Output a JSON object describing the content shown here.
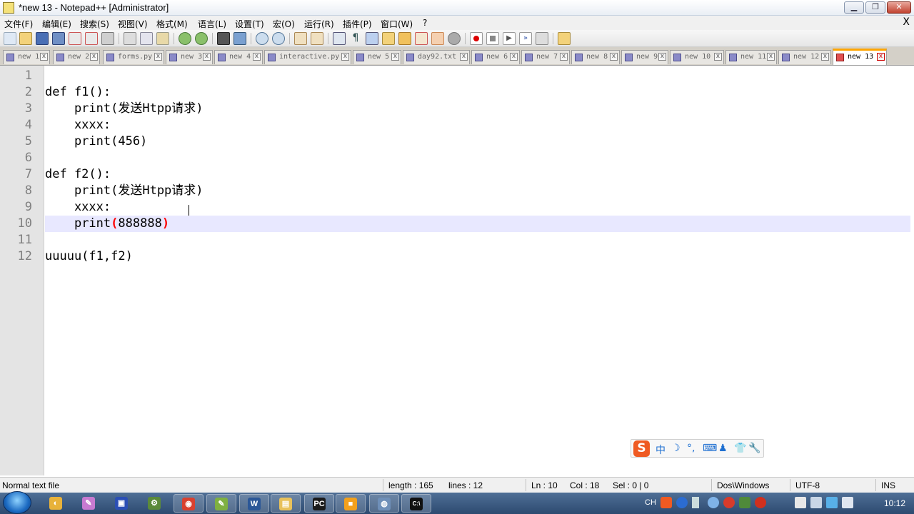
{
  "window": {
    "title": "*new 13 - Notepad++ [Administrator]",
    "min": "▁",
    "max": "❐",
    "close": "✕"
  },
  "menu": {
    "items": [
      "文件(F)",
      "编辑(E)",
      "搜索(S)",
      "视图(V)",
      "格式(M)",
      "语言(L)",
      "设置(T)",
      "宏(O)",
      "运行(R)",
      "插件(P)",
      "窗口(W)",
      "?"
    ],
    "close_doc": "X"
  },
  "tabs": [
    {
      "label": "new 1"
    },
    {
      "label": "new 2"
    },
    {
      "label": "forms.py"
    },
    {
      "label": "new 3"
    },
    {
      "label": "new 4"
    },
    {
      "label": "interactive.py"
    },
    {
      "label": "new 5"
    },
    {
      "label": "day92.txt"
    },
    {
      "label": "new 6"
    },
    {
      "label": "new 7"
    },
    {
      "label": "new 8"
    },
    {
      "label": "new 9"
    },
    {
      "label": "new 10"
    },
    {
      "label": "new 11"
    },
    {
      "label": "new 12"
    },
    {
      "label": "new 13",
      "active": true
    }
  ],
  "tab_close_glyph": "x",
  "editor": {
    "current_line": 10,
    "lines": [
      "",
      "def f1():",
      "    print(发送Htpp请求)",
      "    xxxx:",
      "    print(456)",
      "",
      "def f2():",
      "    print(发送Htpp请求)",
      "    xxxx:",
      "    print(888888)",
      "",
      "uuuuu(f1,f2)"
    ],
    "line10": {
      "indent": "    ",
      "func": "print",
      "open": "(",
      "value": "888888",
      "close": ")"
    },
    "line_numbers": [
      "1",
      "2",
      "3",
      "4",
      "5",
      "6",
      "7",
      "8",
      "9",
      "10",
      "11",
      "12"
    ]
  },
  "ime": {
    "logo": "S",
    "items": [
      "中",
      "☽",
      "°,",
      "⌨",
      "♟",
      "👕",
      "🔧"
    ]
  },
  "status": {
    "file_type": "Normal text file",
    "length": "length : 165",
    "lines": "lines : 12",
    "ln": "Ln : 10",
    "col": "Col : 18",
    "sel": "Sel : 0 | 0",
    "eol": "Dos\\Windows",
    "encoding": "UTF-8",
    "mode": "INS"
  },
  "taskbar": {
    "apps": [
      {
        "name": "chrome-like",
        "glyph": "◐",
        "color": "#e8b23a",
        "open": false
      },
      {
        "name": "paint",
        "glyph": "✎",
        "color": "#c77ad1",
        "open": false
      },
      {
        "name": "save",
        "glyph": "▣",
        "color": "#2b4fb5",
        "open": false
      },
      {
        "name": "tool",
        "glyph": "⚙",
        "color": "#5b8a3a",
        "open": false
      },
      {
        "name": "chrome",
        "glyph": "◉",
        "color": "#d9412f",
        "open": true
      },
      {
        "name": "notepad",
        "glyph": "✎",
        "color": "#7fb041",
        "open": true
      },
      {
        "name": "word",
        "glyph": "W",
        "color": "#2b5797",
        "open": true
      },
      {
        "name": "explorer",
        "glyph": "▤",
        "color": "#e8c15a",
        "open": true
      },
      {
        "name": "pycharm",
        "glyph": "PC",
        "color": "#1b1b1b",
        "open": true
      },
      {
        "name": "app-orange",
        "glyph": "■",
        "color": "#f2a01c",
        "open": true
      },
      {
        "name": "app-blue",
        "glyph": "◍",
        "color": "#6e8fb8",
        "open": true
      },
      {
        "name": "cmd",
        "glyph": "C:\\",
        "color": "#111111",
        "open": true
      }
    ],
    "tray": {
      "lang": "CH",
      "clock": "10:12"
    }
  }
}
